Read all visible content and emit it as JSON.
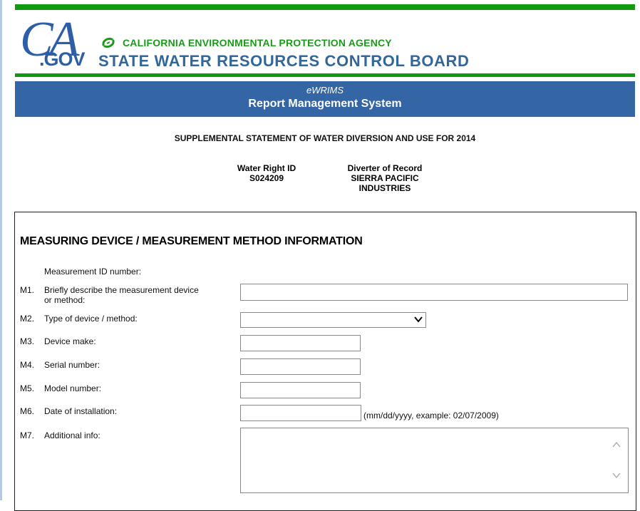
{
  "header": {
    "logo_text": "CA.GOV",
    "logo_gov": ".GOV",
    "agency": "CALIFORNIA ENVIRONMENTAL PROTECTION AGENCY",
    "board": "STATE WATER RESOURCES CONTROL BOARD",
    "banner_sub": "eWRIMS",
    "banner_title": "Report Management System"
  },
  "statement": {
    "title": "SUPPLEMENTAL STATEMENT OF WATER DIVERSION AND USE FOR 2014",
    "water_right_label": "Water Right ID",
    "water_right_value": "S024209",
    "diverter_label": "Diverter of Record",
    "diverter_line1": "SIERRA PACIFIC",
    "diverter_line2": "INDUSTRIES"
  },
  "form": {
    "section_title": "MEASURING DEVICE / MEASUREMENT METHOD INFORMATION",
    "measurement_id_label": "Measurement ID number:",
    "m1": {
      "num": "M1.",
      "label_line1": "Briefly describe the measurement device",
      "label_line2": "or method:",
      "value": ""
    },
    "m2": {
      "num": "M2.",
      "label": "Type of device / method:",
      "selected": ""
    },
    "m3": {
      "num": "M3.",
      "label": "Device make:",
      "value": ""
    },
    "m4": {
      "num": "M4.",
      "label": "Serial number:",
      "value": ""
    },
    "m5": {
      "num": "M5.",
      "label": "Model number:",
      "value": ""
    },
    "m6": {
      "num": "M6.",
      "label": "Date of installation:",
      "value": "",
      "hint": "(mm/dd/yyyy, example: 02/07/2009)"
    },
    "m7": {
      "num": "M7.",
      "label": "Additional info:",
      "value": ""
    }
  },
  "icons": {
    "seal": "leaf-circle-icon",
    "select": "chevron-down-icon",
    "scroll_up": "chevron-up-icon",
    "scroll_down": "chevron-down-icon"
  },
  "colors": {
    "green": "#0f9a0f",
    "blue_banner": "#3465a4",
    "board_text": "#336699",
    "agency_text": "#1a9a1a"
  }
}
